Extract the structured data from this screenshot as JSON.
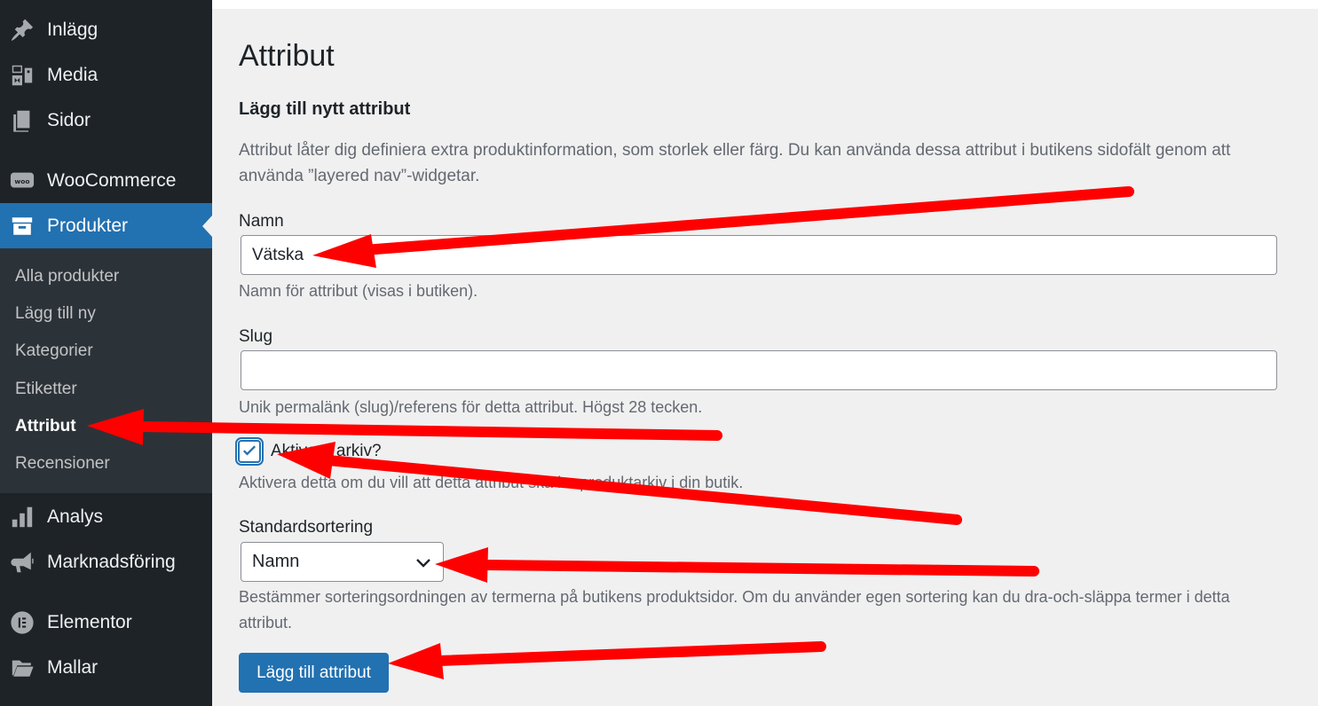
{
  "sidebar": {
    "menu": [
      {
        "label": "Inlägg",
        "icon": "pin-icon"
      },
      {
        "label": "Media",
        "icon": "media-icon"
      },
      {
        "label": "Sidor",
        "icon": "pages-icon"
      },
      {
        "label": "WooCommerce",
        "icon": "woo-icon"
      },
      {
        "label": "Produkter",
        "icon": "archive-icon"
      },
      {
        "label": "Analys",
        "icon": "chart-bar-icon"
      },
      {
        "label": "Marknadsföring",
        "icon": "megaphone-icon"
      },
      {
        "label": "Elementor",
        "icon": "elementor-icon"
      },
      {
        "label": "Mallar",
        "icon": "folder-icon"
      }
    ],
    "active_menu": "Produkter",
    "submenu": [
      "Alla produkter",
      "Lägg till ny",
      "Kategorier",
      "Etiketter",
      "Attribut",
      "Recensioner"
    ],
    "current_submenu": "Attribut"
  },
  "page": {
    "title": "Attribut",
    "section_title": "Lägg till nytt attribut",
    "intro": "Attribut låter dig definiera extra produktinformation, som storlek eller färg. Du kan använda dessa attribut i butikens sidofält genom att använda ”layered nav”-widgetar."
  },
  "form": {
    "name_label": "Namn",
    "name_value": "Vätska",
    "name_hint": "Namn för attribut (visas i butiken).",
    "slug_label": "Slug",
    "slug_value": "",
    "slug_hint": "Unik permalänk (slug)/referens för detta attribut. Högst 28 tecken.",
    "archive_label": "Aktivera arkiv?",
    "archive_checked": true,
    "archive_hint": "Aktivera detta om du vill att detta attribut ska ha produktarkiv i din butik.",
    "sort_label": "Standardsortering",
    "sort_value": "Namn",
    "sort_hint": "Bestämmer sorteringsordningen av termerna på butikens produktsidor. Om du använder egen sortering kan du dra-och-släppa termer i detta attribut.",
    "submit_label": "Lägg till attribut"
  },
  "colors": {
    "sidebar_bg": "#1d2327",
    "submenu_bg": "#2c3338",
    "accent": "#2271b1",
    "annotation_arrow": "#ff0000"
  }
}
